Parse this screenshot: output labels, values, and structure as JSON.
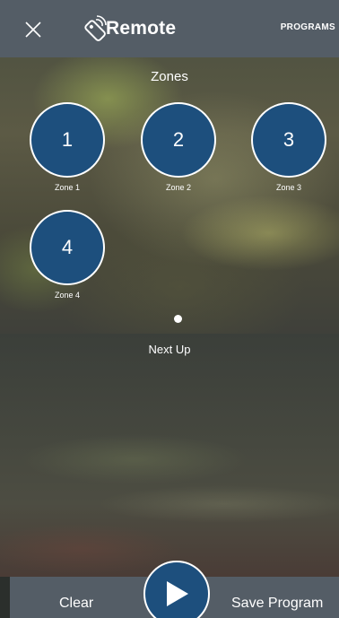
{
  "header": {
    "title": "Remote",
    "programs_label": "PROGRAMS",
    "close_icon": "close-icon",
    "logo_icon": "remote-icon"
  },
  "zones_section": {
    "title": "Zones",
    "zones": [
      {
        "number": "1",
        "label": "Zone 1"
      },
      {
        "number": "2",
        "label": "Zone 2"
      },
      {
        "number": "3",
        "label": "Zone 3"
      },
      {
        "number": "4",
        "label": "Zone 4"
      }
    ],
    "page_indicator": {
      "pages": 1,
      "current": 1
    }
  },
  "next_up": {
    "title": "Next Up"
  },
  "footer": {
    "clear_label": "Clear",
    "save_label": "Save Program",
    "play_icon": "play-icon"
  },
  "colors": {
    "bar": "#545d66",
    "zone_fill": "#1d4f7d",
    "zone_border": "#ffffff"
  }
}
